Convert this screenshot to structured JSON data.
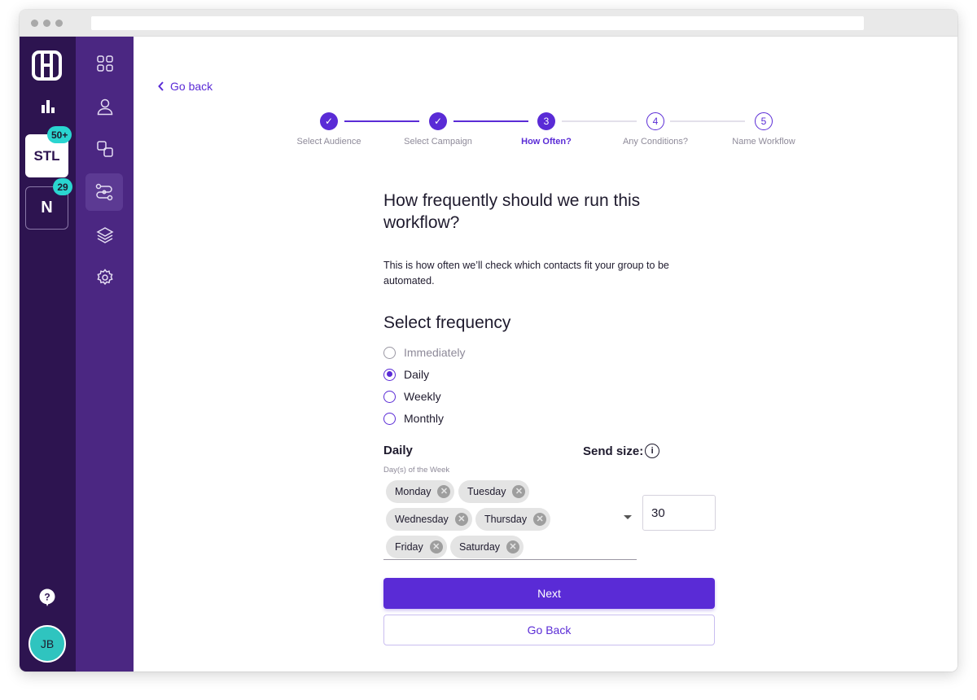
{
  "rail": {
    "workspaces": [
      {
        "label": "STL",
        "badge": "50+"
      },
      {
        "label": "N",
        "badge": "29"
      }
    ],
    "avatar_initials": "JB"
  },
  "nav": {
    "icons": [
      "grid-icon",
      "user-icon",
      "duplicate-icon",
      "workflow-icon",
      "layers-icon",
      "settings-icon"
    ],
    "selected": "workflow-icon"
  },
  "header": {
    "back_link": "Go back"
  },
  "stepper": {
    "steps": [
      {
        "number": "1",
        "label": "Select Audience",
        "status": "done"
      },
      {
        "number": "2",
        "label": "Select Campaign",
        "status": "done"
      },
      {
        "number": "3",
        "label": "How Often?",
        "status": "current"
      },
      {
        "number": "4",
        "label": "Any Conditions?",
        "status": "todo"
      },
      {
        "number": "5",
        "label": "Name Workflow",
        "status": "todo"
      }
    ]
  },
  "form": {
    "title": "How frequently should we run this workflow?",
    "description": "This is how often we’ll check which contacts fit your group to be automated.",
    "frequency_heading": "Select frequency",
    "options": [
      {
        "label": "Immediately",
        "checked": false,
        "disabled": true
      },
      {
        "label": "Daily",
        "checked": true,
        "disabled": false
      },
      {
        "label": "Weekly",
        "checked": false,
        "disabled": false
      },
      {
        "label": "Monthly",
        "checked": false,
        "disabled": false
      }
    ],
    "daily_heading": "Daily",
    "days_label": "Day(s) of the Week",
    "days": [
      "Monday",
      "Tuesday",
      "Wednesday",
      "Thursday",
      "Friday",
      "Saturday"
    ],
    "send_size_label": "Send size:",
    "send_size_value": "30",
    "next_label": "Next",
    "back_label": "Go Back"
  },
  "colors": {
    "accent": "#5a2bd6",
    "rail": "#2d1450",
    "rail2": "#4b2782",
    "badge": "#2ad5d0"
  }
}
